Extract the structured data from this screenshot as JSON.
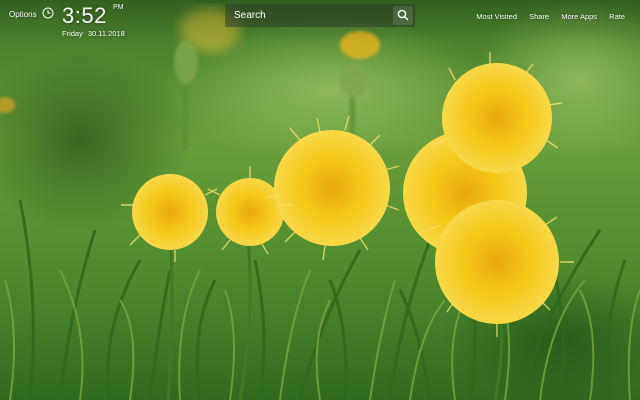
{
  "header": {
    "options_label": "Options",
    "clock_icon": "clock-icon",
    "time": "3:52",
    "period": "PM",
    "weekday": "Friday",
    "date": "30.11.2018"
  },
  "search": {
    "placeholder": "Search",
    "value": "",
    "button_icon": "search-icon"
  },
  "nav": {
    "links": [
      "Most Visited",
      "Share",
      "More Apps",
      "Rate"
    ]
  },
  "wallpaper": {
    "subject": "dandelions-in-grass",
    "colors": {
      "grass": "#4f8a2a",
      "flower": "#f6c818",
      "flower_center": "#e8a80c"
    }
  }
}
